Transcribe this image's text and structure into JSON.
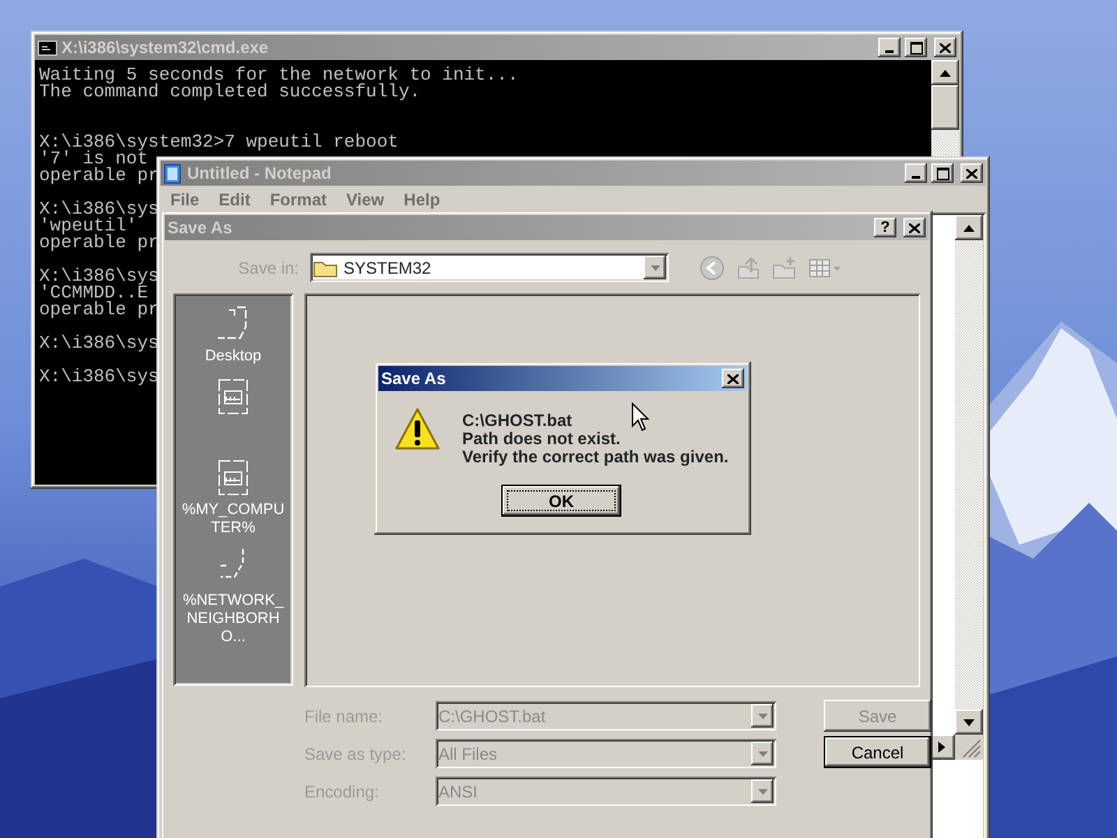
{
  "console": {
    "title": "X:\\i386\\system32\\cmd.exe",
    "active": false,
    "blocks": [
      [
        "Waiting 5 seconds for the network to init...",
        "The command completed successfully."
      ],
      [
        "X:\\i386\\system32>7 wpeutil reboot",
        "'7' is not",
        "operable pr"
      ],
      [
        "X:\\i386\\sys",
        "'wpeutil'",
        "operable pr"
      ],
      [
        "X:\\i386\\sys",
        "'CCMMDD..E",
        "operable pr"
      ],
      [
        "X:\\i386\\sys"
      ],
      [
        "X:\\i386\\sys"
      ]
    ]
  },
  "notepad": {
    "title": "Untitled - Notepad",
    "active": false,
    "menu": [
      "File",
      "Edit",
      "Format",
      "View",
      "Help"
    ]
  },
  "save_dialog": {
    "title": "Save As",
    "active": false,
    "help_button": "?",
    "save_in_label": "Save in:",
    "save_in": "SYSTEM32",
    "places": [
      {
        "kind": "desktop",
        "label": "Desktop"
      },
      {
        "kind": "document"
      },
      {
        "kind": "document",
        "label": "%MY_COMPUTER%"
      },
      {
        "kind": "network",
        "label": "%NETWORK_NEIGHBORHO..."
      }
    ],
    "fields": [
      {
        "label": "File name:",
        "value": "C:\\GHOST.bat"
      },
      {
        "label": "Save as type:",
        "value": "All Files"
      },
      {
        "label": "Encoding:",
        "value": "ANSI"
      }
    ],
    "buttons": [
      {
        "label": "Save",
        "disabled": true
      },
      {
        "label": "Cancel",
        "disabled": false
      }
    ]
  },
  "error_dialog": {
    "title": "Save As",
    "active": true,
    "lines": [
      "C:\\GHOST.bat",
      "Path does not exist.",
      "Verify the correct path was given."
    ],
    "button": "OK"
  }
}
